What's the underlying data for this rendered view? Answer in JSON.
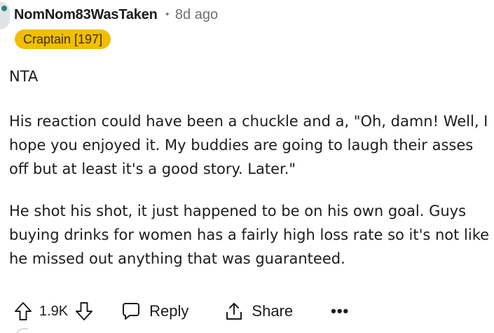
{
  "comment": {
    "username": "NomNom83WasTaken",
    "separator": "•",
    "time": "8d ago",
    "flair": "Craptain [197]",
    "paragraphs": [
      "NTA",
      "His reaction could have been a chuckle and a, \"Oh, damn! Well, I hope you enjoyed it. My buddies are going to laugh their asses off but at least it's a good story. Later.\"",
      "He shot his shot, it just happened to be on his own goal. Guys buying drinks for women has a fairly high loss rate so it's not like he missed out anything that was guaranteed."
    ]
  },
  "actions": {
    "vote_count": "1.9K",
    "reply_label": "Reply",
    "share_label": "Share",
    "more_label": "•••"
  },
  "icons": {
    "upvote": "upvote-arrow-icon",
    "downvote": "downvote-arrow-icon",
    "reply": "comment-bubble-icon",
    "share": "share-icon",
    "more": "ellipsis-icon"
  },
  "colors": {
    "flair_bg": "#f2be00",
    "text": "#1c1c1c",
    "meta": "#6f6f6f"
  }
}
